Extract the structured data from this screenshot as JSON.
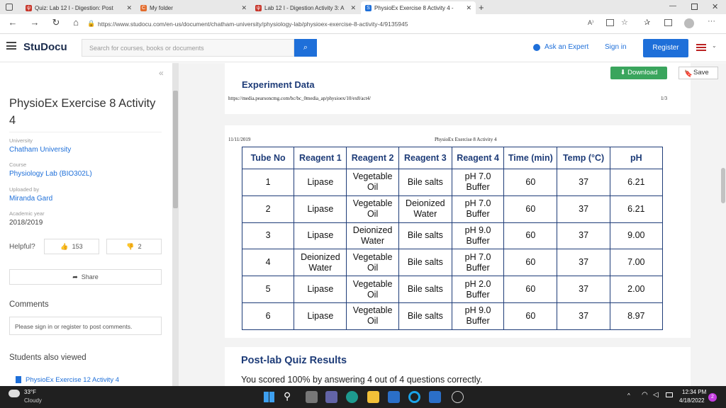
{
  "browser": {
    "tabs": [
      {
        "title": "Quiz: Lab 12 I - Digestion: Post",
        "color": "#c8362b",
        "active": false
      },
      {
        "title": "My folder",
        "color": "#e36b2c",
        "active": false
      },
      {
        "title": "Lab 12 I - Digestion Activity 3: A",
        "color": "#c8362b",
        "active": false
      },
      {
        "title": "PhysioEx Exercise 8 Activity 4 -",
        "color": "#1e6fd9",
        "active": true
      }
    ],
    "url": "https://www.studocu.com/en-us/document/chatham-university/physiology-lab/physioex-exercise-8-activity-4/9135945"
  },
  "site": {
    "logo": "StuDocu",
    "search_placeholder": "Search for courses, books or documents",
    "ask_expert": "Ask an Expert",
    "sign_in": "Sign in",
    "register": "Register"
  },
  "sidebar": {
    "collapse": "«",
    "title": "PhysioEx Exercise 8 Activity 4",
    "university_label": "University",
    "university": "Chatham University",
    "course_label": "Course",
    "course": "Physiology Lab (BIO302L)",
    "uploaded_label": "Uploaded by",
    "uploader": "Miranda Gard",
    "year_label": "Academic year",
    "year": "2018/2019",
    "helpful_label": "Helpful?",
    "upvotes": "153",
    "downvotes": "2",
    "share": "Share",
    "comments_heading": "Comments",
    "comment_prompt": "Please sign in or register to post comments.",
    "also_viewed": "Students also viewed",
    "also_item": "PhysioEx Exercise 12 Activity 4"
  },
  "toolbar": {
    "download": "Download",
    "save": "Save"
  },
  "doc": {
    "section_heading": "Experiment Data",
    "page1_url": "https://media.pearsoncmg.com/bc/bc_0media_ap/physioex/10/ex8/act4/",
    "page1_num": "1/3",
    "page2_date": "11/11/2019",
    "page2_header": "PhysioEx Exercise 8 Activity 4",
    "table": {
      "headers": [
        "Tube No",
        "Reagent 1",
        "Reagent 2",
        "Reagent 3",
        "Reagent 4",
        "Time (min)",
        "Temp (°C)",
        "pH"
      ],
      "rows": [
        [
          "1",
          "Lipase",
          "Vegetable Oil",
          "Bile salts",
          "pH 7.0 Buffer",
          "60",
          "37",
          "6.21"
        ],
        [
          "2",
          "Lipase",
          "Vegetable Oil",
          "Deionized Water",
          "pH 7.0 Buffer",
          "60",
          "37",
          "6.21"
        ],
        [
          "3",
          "Lipase",
          "Deionized Water",
          "Bile salts",
          "pH 9.0 Buffer",
          "60",
          "37",
          "9.00"
        ],
        [
          "4",
          "Deionized Water",
          "Vegetable Oil",
          "Bile salts",
          "pH 7.0 Buffer",
          "60",
          "37",
          "7.00"
        ],
        [
          "5",
          "Lipase",
          "Vegetable Oil",
          "Bile salts",
          "pH 2.0 Buffer",
          "60",
          "37",
          "2.00"
        ],
        [
          "6",
          "Lipase",
          "Vegetable Oil",
          "Bile salts",
          "pH 9.0 Buffer",
          "60",
          "37",
          "8.97"
        ]
      ]
    },
    "quiz_heading": "Post-lab Quiz Results",
    "quiz_text": "You scored 100% by answering 4 out of 4 questions correctly."
  },
  "taskbar": {
    "temp": "33°F",
    "weather": "Cloudy",
    "time": "12:34 PM",
    "date": "4/18/2022",
    "notif": "2"
  }
}
